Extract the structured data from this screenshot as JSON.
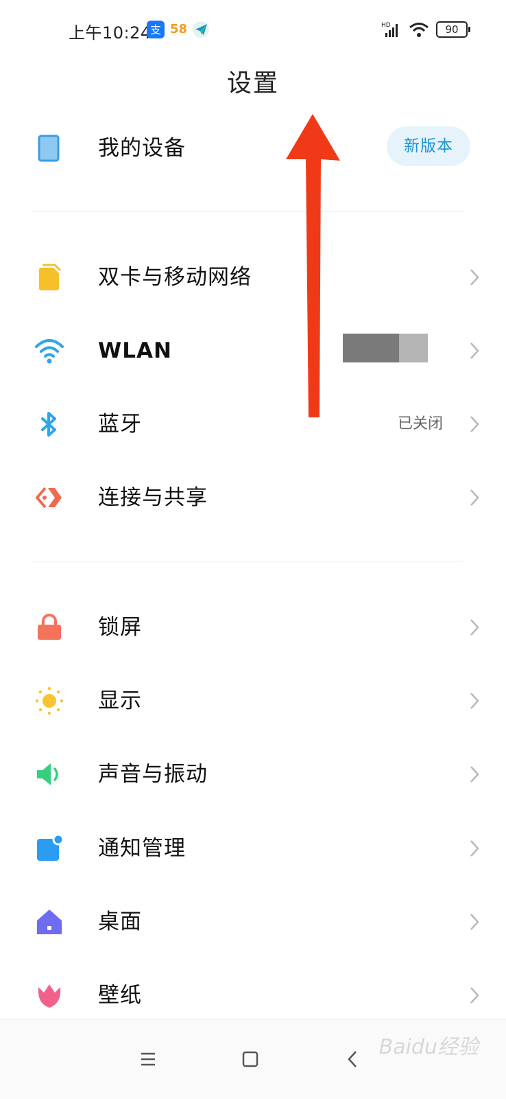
{
  "status_bar": {
    "time": "上午10:24",
    "battery": "90",
    "notification_icons": [
      "alipay-icon",
      "58-app-icon",
      "send-paper-plane-icon"
    ],
    "app_58_label": "58",
    "network_label": "HD"
  },
  "page": {
    "title": "设置"
  },
  "my_device": {
    "label": "我的设备",
    "badge": "新版本"
  },
  "network_section": [
    {
      "id": "sim",
      "label": "双卡与移动网络",
      "value": "",
      "icon": "sim-card-icon"
    },
    {
      "id": "wlan",
      "label": "WLAN",
      "value": "",
      "icon": "wifi-icon"
    },
    {
      "id": "bluetooth",
      "label": "蓝牙",
      "value": "已关闭",
      "icon": "bluetooth-icon"
    },
    {
      "id": "share",
      "label": "连接与共享",
      "value": "",
      "icon": "share-connection-icon"
    }
  ],
  "display_section": [
    {
      "id": "lockscreen",
      "label": "锁屏",
      "icon": "lock-icon"
    },
    {
      "id": "display",
      "label": "显示",
      "icon": "sun-icon"
    },
    {
      "id": "sound",
      "label": "声音与振动",
      "icon": "speaker-icon"
    },
    {
      "id": "notifications",
      "label": "通知管理",
      "icon": "notification-icon"
    },
    {
      "id": "desktop",
      "label": "桌面",
      "icon": "home-icon"
    },
    {
      "id": "wallpaper",
      "label": "壁纸",
      "icon": "tulip-icon"
    }
  ],
  "colors": {
    "accent_blue": "#1c93d6",
    "arrow_red": "#f03a17",
    "sim_yellow": "#f7bf2a",
    "wifi_blue": "#2ea6ea",
    "share_red": "#ef6a50",
    "lock_orange": "#f5735a",
    "sun_yellow": "#f8c330",
    "sound_green": "#35cf7d",
    "notify_blue": "#2a9cf2",
    "home_purple": "#6e6cf0",
    "tulip_pink": "#f0628a"
  },
  "watermark": "Baidu经验"
}
